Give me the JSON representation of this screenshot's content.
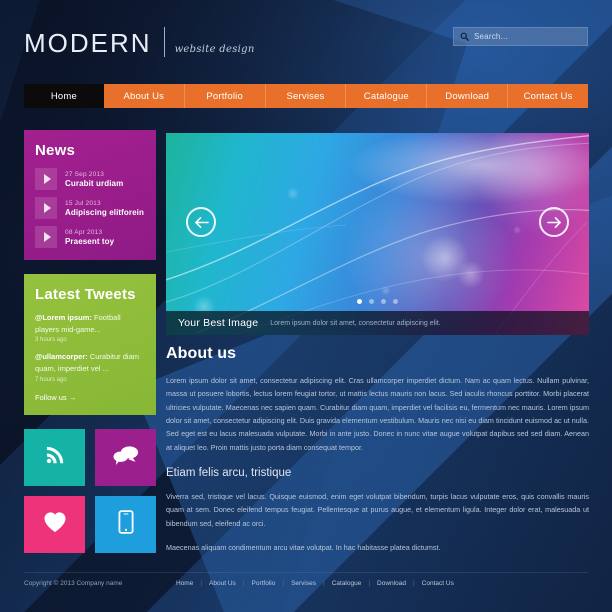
{
  "header": {
    "logo_main": "MODERN",
    "logo_sub": "website design",
    "search_placeholder": "Search...",
    "search_value": ""
  },
  "nav": {
    "items": [
      {
        "label": "Home",
        "active": true
      },
      {
        "label": "About Us",
        "active": false
      },
      {
        "label": "Portfolio",
        "active": false
      },
      {
        "label": "Servises",
        "active": false
      },
      {
        "label": "Catalogue",
        "active": false
      },
      {
        "label": "Download",
        "active": false
      },
      {
        "label": "Contact Us",
        "active": false
      }
    ]
  },
  "news": {
    "title": "News",
    "items": [
      {
        "date": "27 Sep 2013",
        "headline": "Curabit urdiam"
      },
      {
        "date": "15 Jul 2013",
        "headline": "Adipiscing elitforein"
      },
      {
        "date": "08 Apr 2013",
        "headline": "Praesent toy"
      }
    ]
  },
  "tweets": {
    "title": "Latest Tweets",
    "items": [
      {
        "user": "@Lorem ipsum:",
        "text": " Football players mid-game...",
        "time": "3 hours ago"
      },
      {
        "user": "@ullamcorper:",
        "text": " Curabitur diam quam, imperdiet vel ...",
        "time": "7 hours ago"
      }
    ],
    "follow_label": "Follow us →"
  },
  "social": {
    "tiles": [
      {
        "name": "rss",
        "color": "#15b2a6"
      },
      {
        "name": "chat",
        "color": "#9c1f8e"
      },
      {
        "name": "heart",
        "color": "#ed3379"
      },
      {
        "name": "mobile",
        "color": "#1f9ede"
      }
    ]
  },
  "hero": {
    "caption_title": "Your Best Image",
    "caption_sub": "Lorem ipsum dolor sit amet, consectetur adipiscing elit.",
    "dots": 4,
    "active_dot": 1
  },
  "content": {
    "heading": "About us",
    "paragraph1": "Lorem ipsum dolor sit amet, consectetur adipiscing elit. Cras ullamcorper imperdiet dictum. Nam ac quam lectus. Nullam pulvinar, massa ut posuere lobortis, lectus lorem feugiat tortor, ut mattis lectus mauris non lacus. Sed iaculis rhoncus porttitor. Morbi placerat ultricies vulputate. Maecenas nec sapien quam. Curabitur diam quam, imperdiet vel facilisis eu, fermentum nec mauris. Lorem ipsum dolor sit amet, consectetur adipiscing elit. Duis gravida elementum vestibulum. Mauris nec nisi eu diam tincidunt euismod ac ut nulla. Sed eget est eu lacus malesuada vulputate. Morbi in ante justo. Donec in nunc vitae augue volutpat dapibus sed sed diam. Aenean at aliquet leo. Proin mattis justo porta diam consequat tempor.",
    "subheading": "Etiam felis arcu, tristique",
    "paragraph2": "Viverra sed, tristique vel lacus. Quisque euismod, enim eget volutpat bibendum, turpis lacus vulputate eros, quis convallis mauris quam at sem. Donec eleifend tempus feugiat. Pellentesque at purus augue, et elementum ligula. Integer dolor erat, malesuada ut bibendum sed, eleifend ac orci.",
    "paragraph3": "Maecenas aliquam condimentum arcu vitae volutpat. In hac habitasse platea dictumst."
  },
  "footer": {
    "copyright": "Copyright © 2013 Company name",
    "links": [
      "Home",
      "About Us",
      "Portfolio",
      "Servises",
      "Catalogue",
      "Download",
      "Contact Us"
    ],
    "separator": "|"
  },
  "colors": {
    "accent_orange": "#e8702a",
    "news_purple": "#9c1f8e",
    "tweets_green": "#95c23e",
    "background_navy": "#0d1a33"
  }
}
